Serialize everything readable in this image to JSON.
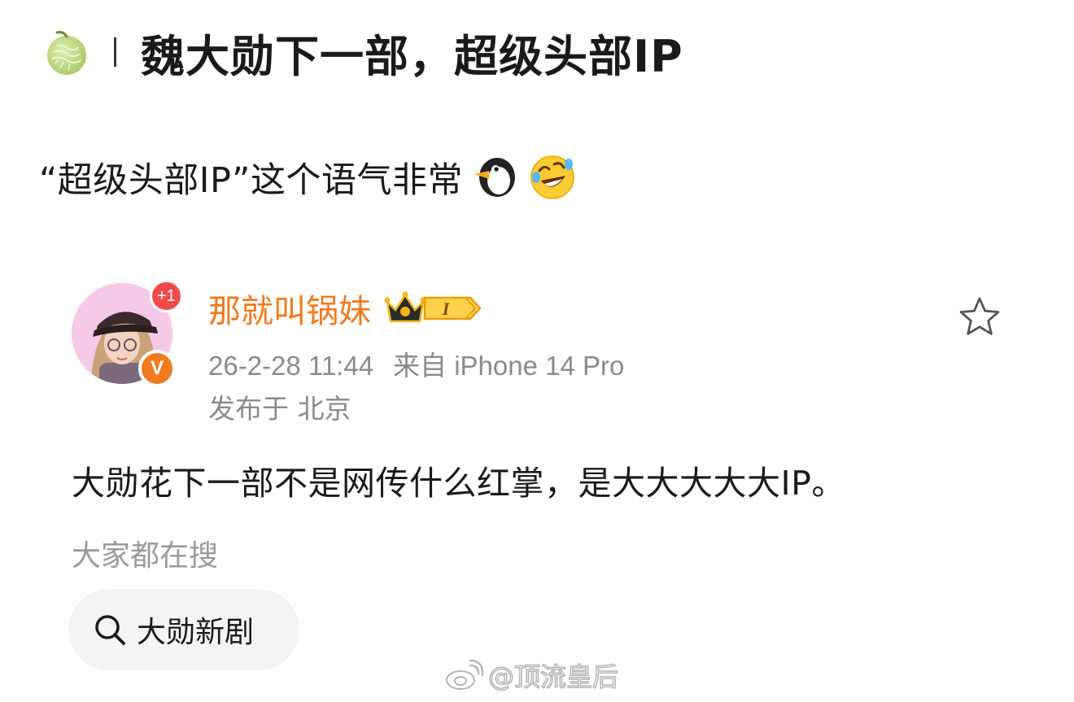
{
  "header": {
    "icon": "melon-icon",
    "title": "魏大勋下一部，超级头部IP"
  },
  "caption": {
    "text": "“超级头部IP”这个语气非常",
    "emojis": [
      "penguin-icon",
      "rolling-on-floor-laughing-icon"
    ]
  },
  "post": {
    "avatar": {
      "badge_count": "+1",
      "verified_mark": "V",
      "verified_color": "#f07a1e"
    },
    "username": "那就叫锅妹",
    "username_color": "#f07a1e",
    "vip_level": "I",
    "timestamp": "26-2-28 11:44",
    "source": "来自 iPhone 14 Pro",
    "location": "发布于 北京",
    "body": "大勋花下一部不是网传什么红掌，是大大大大大IP。",
    "trending_label": "大家都在搜",
    "trending_chip": "大勋新剧"
  },
  "watermark": {
    "text": "@顶流皇后",
    "icon": "weibo-icon"
  }
}
